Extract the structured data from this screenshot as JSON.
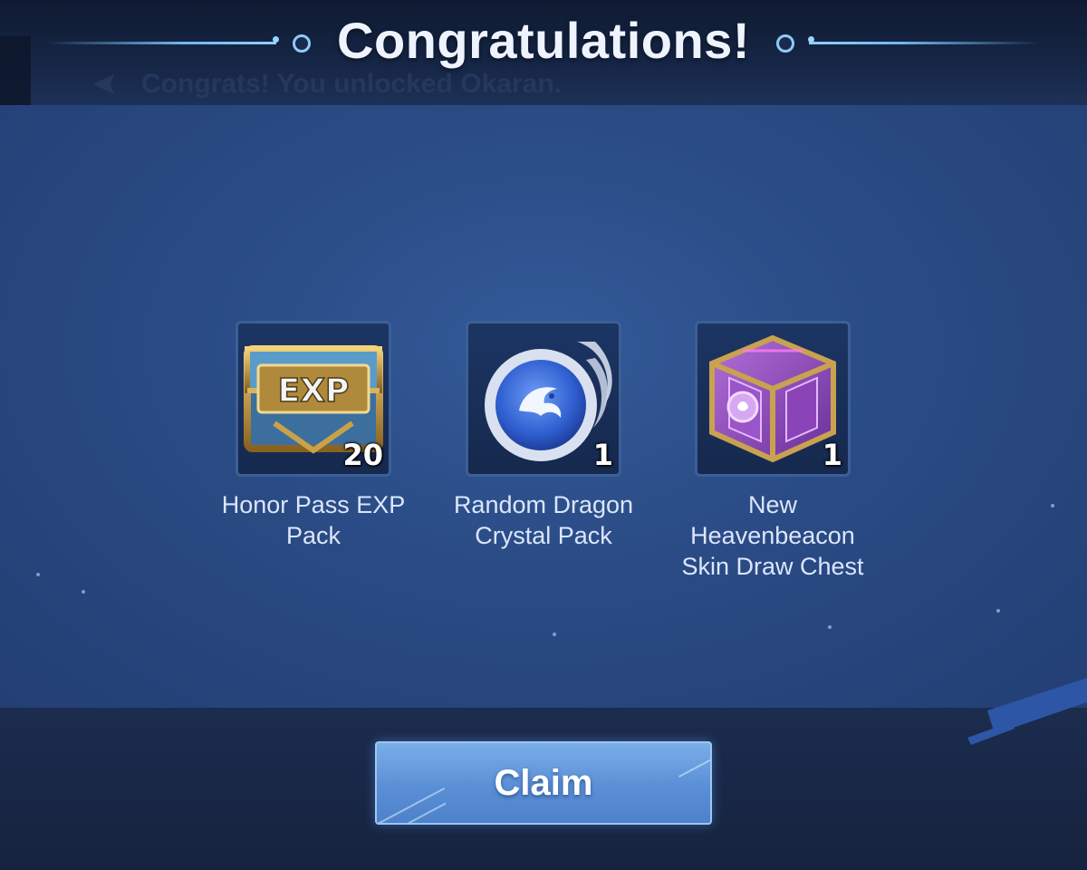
{
  "header": {
    "title": "Congratulations!",
    "background_notice": "Congrats! You unlocked Okaran."
  },
  "rewards": [
    {
      "name_line1": "Honor Pass EXP",
      "name_line2": "Pack",
      "name_line3": "",
      "count": "20",
      "icon": "exp-chest-icon"
    },
    {
      "name_line1": "Random Dragon",
      "name_line2": "Crystal Pack",
      "name_line3": "",
      "count": "1",
      "icon": "dragon-crystal-icon"
    },
    {
      "name_line1": "New",
      "name_line2": "Heavenbeacon",
      "name_line3": "Skin Draw Chest",
      "count": "1",
      "icon": "heavenbeacon-cube-icon"
    }
  ],
  "footer": {
    "claim_label": "Claim"
  },
  "colors": {
    "panel": "#2a4b85",
    "header": "#17284a",
    "accent": "#6fb8ec",
    "button": "#5a8fd6"
  }
}
